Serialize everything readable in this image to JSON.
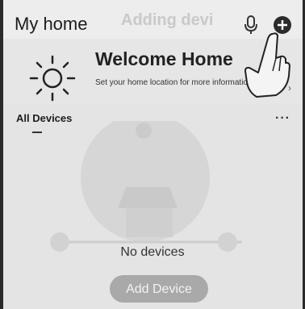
{
  "header": {
    "title": "My home",
    "background_text": "Adding devi",
    "mic_icon": "microphone-icon",
    "add_icon": "plus-circle-icon"
  },
  "banner": {
    "icon": "sun-icon",
    "title": "Welcome Home",
    "subtitle": "Set your home location for more information",
    "arrow": "›"
  },
  "devices": {
    "section_title": "All Devices",
    "more_icon": "···",
    "empty_text": "No devices",
    "add_button_label": "Add Device"
  },
  "annotation": {
    "hand_icon": "pointing-hand-icon"
  },
  "colors": {
    "background": "#e4e4e4",
    "header": "#ededed",
    "button": "#a9a9a9",
    "text": "#1f1f1f"
  }
}
